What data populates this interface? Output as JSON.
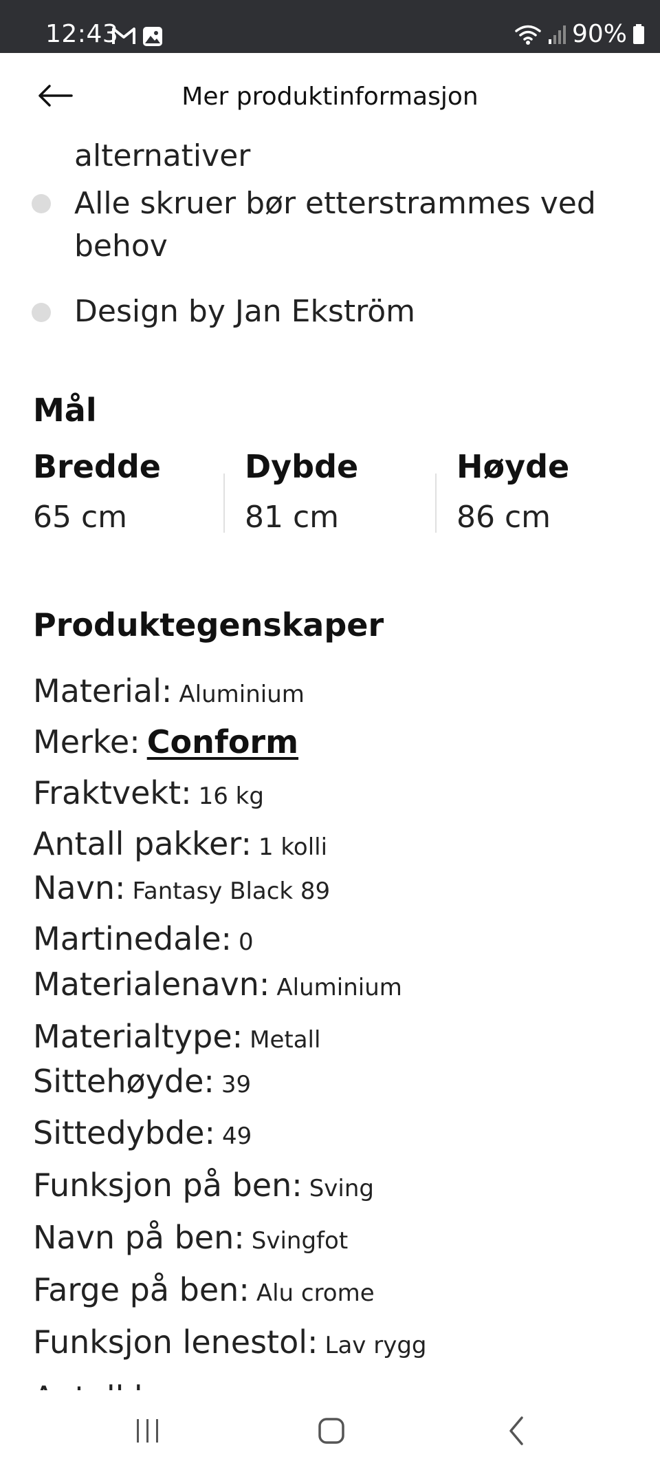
{
  "status_bar": {
    "time": "12:43",
    "battery": "90%",
    "icons_left": [
      "gmail-icon",
      "gallery-icon"
    ],
    "icons_right": [
      "wifi-icon",
      "signal-icon",
      "battery-icon"
    ]
  },
  "header": {
    "title": "Mer produktinformasjon",
    "back_icon": "arrow-left-icon"
  },
  "bullets": [
    "alternativer",
    "Alle skruer bør etterstrammes ved",
    "behov",
    "Design by Jan Ekström"
  ],
  "dimensions": {
    "title": "Mål",
    "items": [
      {
        "label": "Bredde",
        "value": "65 cm"
      },
      {
        "label": "Dybde",
        "value": "81 cm"
      },
      {
        "label": "Høyde",
        "value": "86 cm"
      }
    ]
  },
  "properties": {
    "title": "Produktegenskaper",
    "items": [
      {
        "key": "Material:",
        "value": "Aluminium"
      },
      {
        "key": "Merke:",
        "value": "Conform",
        "link": true
      },
      {
        "key": "Fraktvekt:",
        "value": "16 kg"
      },
      {
        "key": "Antall pakker:",
        "value": "1 kolli"
      },
      {
        "key": "Navn:",
        "value": "Fantasy Black 89"
      },
      {
        "key": "Martinedale:",
        "value": "0"
      },
      {
        "key": "Materialenavn:",
        "value": "Aluminium"
      },
      {
        "key": "Materialtype:",
        "value": "Metall"
      },
      {
        "key": "Sittehøyde:",
        "value": "39"
      },
      {
        "key": "Sittedybde:",
        "value": "49"
      },
      {
        "key": "Funksjon på ben:",
        "value": "Sving"
      },
      {
        "key": "Navn på ben:",
        "value": "Svingfot"
      },
      {
        "key": "Farge på ben:",
        "value": "Alu crome"
      },
      {
        "key": "Funksjon lenestol:",
        "value": "Lav rygg"
      }
    ],
    "cutoff_text": "Antall b"
  },
  "nav_bar": {
    "buttons": [
      "recents-icon",
      "home-icon",
      "back-icon"
    ]
  },
  "colors": {
    "status_bar_bg": "#2f3034",
    "bullet_dot": "#dcdcdc",
    "text": "#222222"
  }
}
